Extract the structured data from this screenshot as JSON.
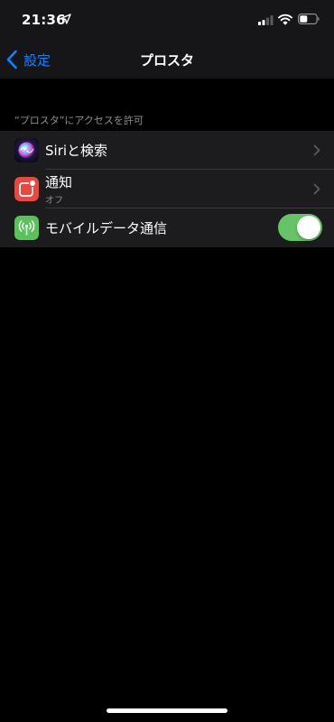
{
  "status_bar": {
    "time": "21:36",
    "location_icon": "location-arrow-icon",
    "signal_icon": "cellular-signal-icon",
    "wifi_icon": "wifi-icon",
    "battery_icon": "battery-icon"
  },
  "nav": {
    "back_label": "設定",
    "title": "プロスタ"
  },
  "section": {
    "header": "“プロスタ”にアクセスを許可"
  },
  "rows": [
    {
      "title": "Siriと検索",
      "icon": "siri-icon"
    },
    {
      "title": "通知",
      "subtitle": "オフ",
      "icon": "notifications-icon"
    },
    {
      "title": "モバイルデータ通信",
      "icon": "cellular-data-icon",
      "toggle_on": true
    }
  ],
  "colors": {
    "accent": "#0a84ff",
    "toggle_on": "#65c466",
    "notification_icon": "#e8493f",
    "cellular_icon": "#5ac25a"
  }
}
